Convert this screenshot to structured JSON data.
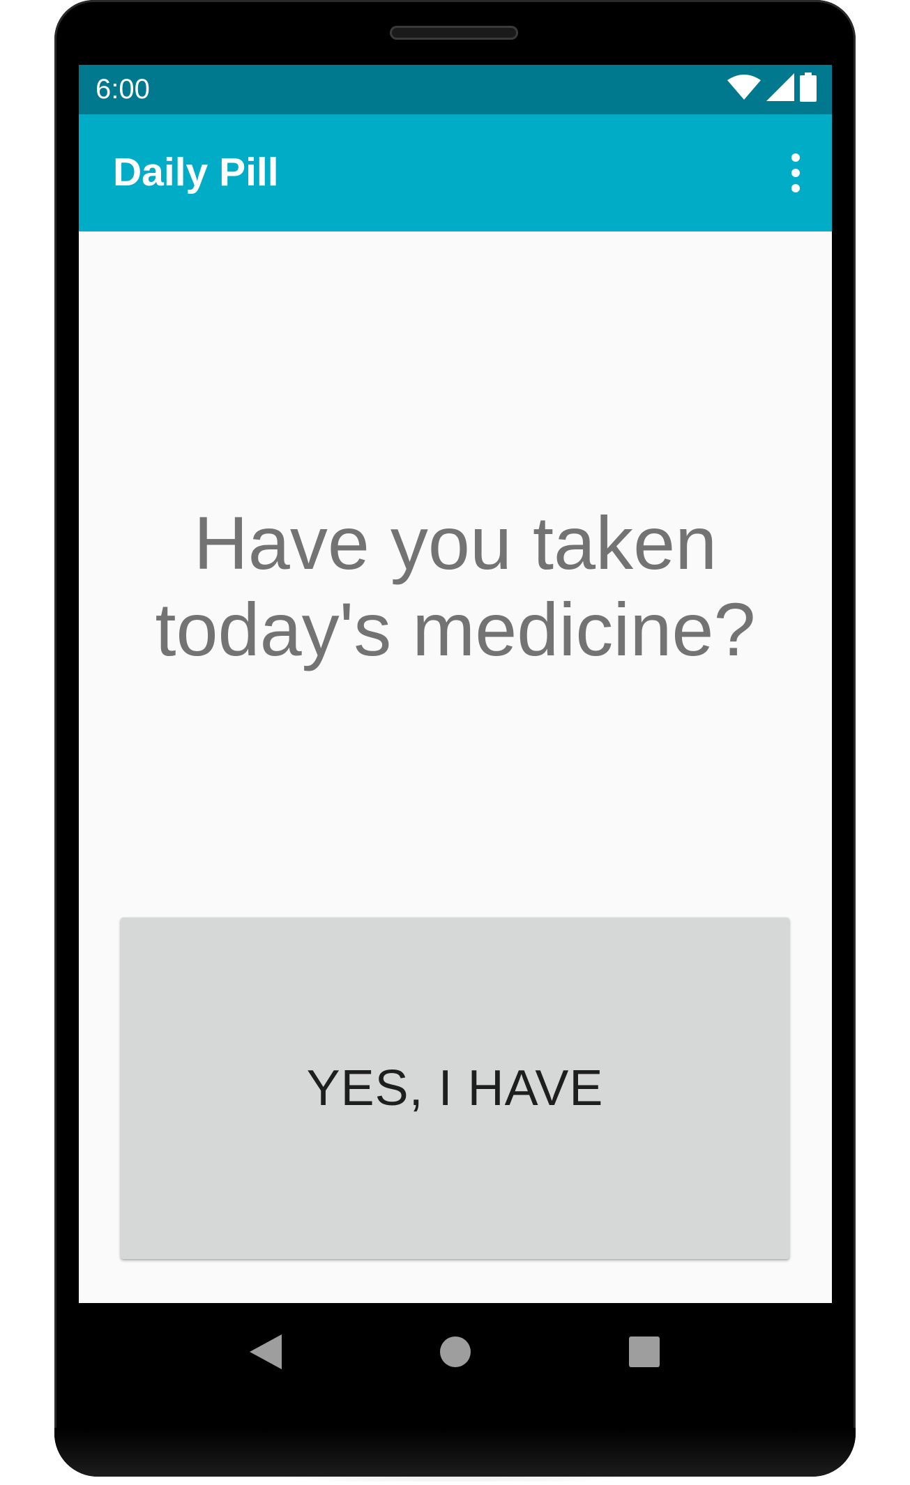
{
  "status_bar": {
    "time": "6:00",
    "icons": [
      "wifi-icon",
      "cell-signal-icon",
      "battery-icon"
    ],
    "color": "#00798f"
  },
  "app_bar": {
    "title": "Daily Pill",
    "menu_icon": "more-vert-icon",
    "color": "#00acc6"
  },
  "main": {
    "question": "Have you taken today's medicine?",
    "yes_button_label": "YES, I HAVE"
  },
  "nav_bar": {
    "buttons": [
      "back-icon",
      "home-icon",
      "recents-icon"
    ]
  },
  "colors": {
    "question_text": "#737373",
    "button_bg": "#d6d7d7",
    "background": "#fafafa"
  }
}
